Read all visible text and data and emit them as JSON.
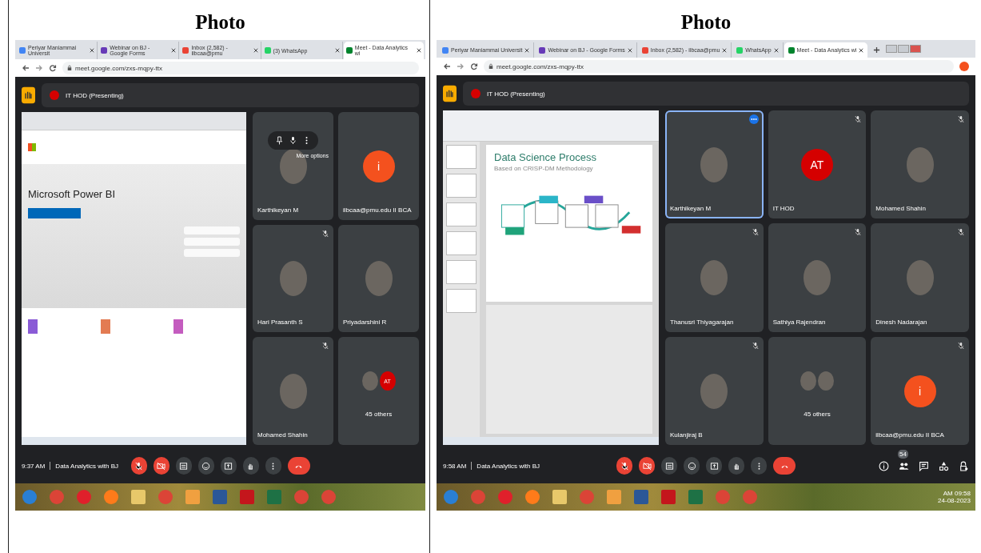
{
  "columns": [
    {
      "heading": "Photo",
      "browser": {
        "tabs": [
          {
            "title": "Periyar Maniammai Universit",
            "color": "#4285f4",
            "selected": false
          },
          {
            "title": "Webinar on BJ - Google Forms",
            "color": "#673ab7",
            "selected": false
          },
          {
            "title": "Inbox (2,582) - ilbcaa@pmu",
            "color": "#ea4335",
            "selected": false
          },
          {
            "title": "(3) WhatsApp",
            "color": "#25d366",
            "selected": false
          },
          {
            "title": "Meet - Data Analytics wi",
            "color": "#00832d",
            "selected": true
          }
        ],
        "url": "meet.google.com/zxs-mqpy-ttx"
      },
      "meet": {
        "presenter": "IT HOD (Presenting)",
        "shared_screen": {
          "kind": "web_page",
          "heading": "Microsoft Power BI"
        },
        "tiles": [
          {
            "kind": "person",
            "name": "Karthikeyan M",
            "avatar": {
              "kind": "photo"
            },
            "muted": false,
            "highlighted": false,
            "hover_label": "More options"
          },
          {
            "kind": "person",
            "name": "ilbcaa@pmu.edu II BCA",
            "avatar": {
              "kind": "letter",
              "letter": "i"
            },
            "muted": false,
            "highlighted": false
          },
          {
            "kind": "person",
            "name": "Hari Prasanth S",
            "avatar": {
              "kind": "photo"
            },
            "muted": true,
            "highlighted": false
          },
          {
            "kind": "person",
            "name": "Priyadarshini R",
            "avatar": {
              "kind": "photo"
            },
            "muted": false,
            "highlighted": false
          },
          {
            "kind": "person",
            "name": "Mohamed Shahin",
            "avatar": {
              "kind": "photo"
            },
            "muted": true,
            "highlighted": false
          },
          {
            "kind": "others",
            "name": "45 others",
            "second_letter": "AT"
          }
        ],
        "time": "9:37 AM",
        "meeting_title": "Data Analytics with BJ",
        "controls": [
          {
            "kind": "mic",
            "on": false
          },
          {
            "kind": "camera",
            "on": false
          },
          {
            "kind": "captions",
            "on": false
          },
          {
            "kind": "emoji",
            "on": false
          },
          {
            "kind": "present",
            "on": false
          },
          {
            "kind": "hand",
            "on": false
          },
          {
            "kind": "more",
            "on": false
          },
          {
            "kind": "end"
          }
        ]
      },
      "taskbar": {
        "apps": [
          {
            "kind": "start"
          },
          {
            "kind": "chrome"
          },
          {
            "kind": "opera"
          },
          {
            "kind": "firefox"
          },
          {
            "kind": "files"
          },
          {
            "kind": "chrome"
          },
          {
            "kind": "media"
          },
          {
            "kind": "word"
          },
          {
            "kind": "acrobat"
          },
          {
            "kind": "excel"
          },
          {
            "kind": "chrome"
          },
          {
            "kind": "chrome"
          }
        ]
      }
    },
    {
      "heading": "Photo",
      "browser": {
        "tabs": [
          {
            "title": "Periyar Maniammai Universit",
            "color": "#4285f4",
            "selected": false
          },
          {
            "title": "Webinar on BJ - Google Forms",
            "color": "#673ab7",
            "selected": false
          },
          {
            "title": "Inbox (2,582) - ilbcaa@pmu",
            "color": "#ea4335",
            "selected": false
          },
          {
            "title": "WhatsApp",
            "color": "#25d366",
            "selected": false
          },
          {
            "title": "Meet - Data Analytics wi",
            "color": "#00832d",
            "selected": true
          }
        ],
        "url": "meet.google.com/zxs-mqpy-ttx",
        "new_tab_button": true,
        "window_controls": true,
        "profile_button": true
      },
      "meet": {
        "presenter": "IT HOD (Presenting)",
        "shared_screen": {
          "kind": "slides",
          "heading": "Data Science Process",
          "subheading": "Based on CRISP-DM Methodology"
        },
        "tiles": [
          {
            "kind": "person",
            "name": "Karthikeyan M",
            "avatar": {
              "kind": "photo"
            },
            "muted": false,
            "highlighted": true
          },
          {
            "kind": "person",
            "name": "IT HOD",
            "avatar": {
              "kind": "letter",
              "letter": "AT"
            },
            "muted": true,
            "highlighted": false
          },
          {
            "kind": "person",
            "name": "Mohamed Shahin",
            "avatar": {
              "kind": "photo"
            },
            "muted": true,
            "highlighted": false
          },
          {
            "kind": "person",
            "name": "Thanusri Thiyagarajan",
            "avatar": {
              "kind": "photo"
            },
            "muted": true,
            "highlighted": false
          },
          {
            "kind": "person",
            "name": "Sathiya Rajendran",
            "avatar": {
              "kind": "photo"
            },
            "muted": true,
            "highlighted": false
          },
          {
            "kind": "person",
            "name": "Dinesh Nadarajan",
            "avatar": {
              "kind": "photo"
            },
            "muted": true,
            "highlighted": false
          },
          {
            "kind": "person",
            "name": "Kulanjiraj B",
            "avatar": {
              "kind": "photo"
            },
            "muted": true,
            "highlighted": false
          },
          {
            "kind": "others",
            "name": "45 others"
          },
          {
            "kind": "person",
            "name": "ilbcaa@pmu.edu II BCA",
            "avatar": {
              "kind": "letter",
              "letter": "i"
            },
            "muted": true,
            "highlighted": false
          }
        ],
        "time": "9:58 AM",
        "meeting_title": "Data Analytics with BJ",
        "controls": [
          {
            "kind": "mic",
            "on": false
          },
          {
            "kind": "camera",
            "on": false
          },
          {
            "kind": "captions",
            "on": false
          },
          {
            "kind": "emoji",
            "on": false
          },
          {
            "kind": "present",
            "on": false
          },
          {
            "kind": "hand",
            "on": false
          },
          {
            "kind": "more",
            "on": false
          },
          {
            "kind": "end"
          }
        ],
        "side_controls": [
          {
            "kind": "info"
          },
          {
            "kind": "people",
            "badge": "54"
          },
          {
            "kind": "chat"
          },
          {
            "kind": "activities"
          },
          {
            "kind": "host"
          }
        ]
      },
      "taskbar": {
        "apps": [
          {
            "kind": "start"
          },
          {
            "kind": "chrome"
          },
          {
            "kind": "opera"
          },
          {
            "kind": "firefox"
          },
          {
            "kind": "files"
          },
          {
            "kind": "chrome"
          },
          {
            "kind": "media"
          },
          {
            "kind": "word"
          },
          {
            "kind": "acrobat"
          },
          {
            "kind": "excel"
          },
          {
            "kind": "chrome"
          },
          {
            "kind": "chrome"
          }
        ],
        "clock_time": "AM 09:58",
        "clock_date": "24-08-2023"
      }
    }
  ]
}
